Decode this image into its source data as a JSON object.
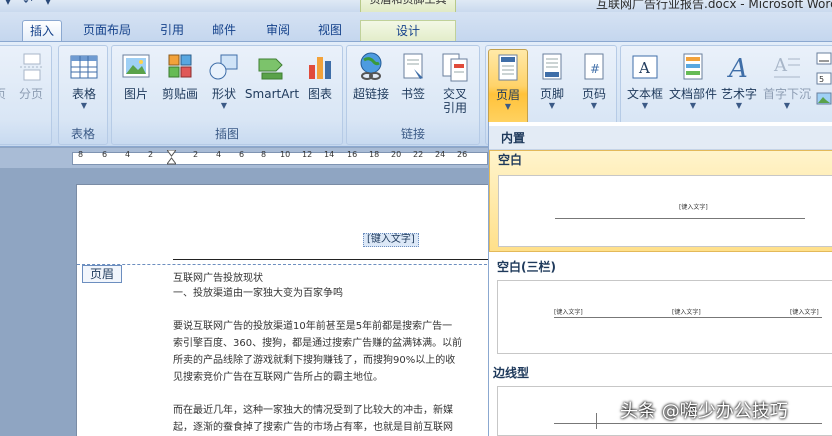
{
  "window": {
    "context_tools_title": "页眉和页脚工具",
    "document_title": "互联网广告行业报告.docx - Microsoft Word"
  },
  "tabs": [
    {
      "label": "插入",
      "active": true
    },
    {
      "label": "页面布局"
    },
    {
      "label": "引用"
    },
    {
      "label": "邮件"
    },
    {
      "label": "审阅"
    },
    {
      "label": "视图"
    },
    {
      "label": "设计",
      "contextual": true
    }
  ],
  "ribbon": {
    "groups": {
      "pages": {
        "partial_label": "页",
        "split_label": "分页"
      },
      "table": {
        "label": "表格",
        "button": "表格"
      },
      "illustrations": {
        "label": "插图",
        "picture": "图片",
        "clipart": "剪贴画",
        "shapes": "形状",
        "smartart": "SmartArt",
        "chart": "图表"
      },
      "links": {
        "label": "链接",
        "hyperlink": "超链接",
        "bookmark": "书签",
        "crossref_1": "交叉",
        "crossref_2": "引用"
      },
      "header_footer": {
        "header": "页眉",
        "footer": "页脚",
        "page_number": "页码"
      },
      "text": {
        "textbox": "文本框",
        "quickparts": "文档部件",
        "wordart": "艺术字",
        "dropcap": "首字下沉"
      }
    }
  },
  "ruler": {
    "ticks": [
      "8",
      "6",
      "4",
      "2",
      "2",
      "4",
      "6",
      "8",
      "10",
      "12",
      "14",
      "16",
      "18",
      "20",
      "22",
      "24",
      "26"
    ]
  },
  "document": {
    "header_field": "[键入文字]",
    "header_tag": "页眉",
    "lines": [
      "互联网广告投放现状",
      "一、投放渠道由一家独大变为百家争鸣",
      "要说互联网广告的投放渠道10年前甚至是5年前都是搜索广告一",
      "索引擎百度、360、搜狗，都是通过搜索广告赚的盆满钵满。以前",
      "所卖的产品线除了游戏就剩下搜狗赚钱了，而搜狗90%以上的收",
      "见搜索竞价广告在互联网广告所占的霸主地位。",
      "而在最近几年，这种一家独大的情况受到了比较大的冲击，新媒",
      "起，逐渐的蚕食掉了搜索广告的市场占有率，也就是目前互联网"
    ]
  },
  "gallery": {
    "section": "内置",
    "items": [
      {
        "name": "空白",
        "placeholder": "[键入文字]",
        "selected": true
      },
      {
        "name": "空白(三栏)",
        "placeholders": [
          "[键入文字]",
          "[键入文字]",
          "[键入文字]"
        ]
      },
      {
        "name": "边线型"
      }
    ]
  },
  "watermark": "头条 @嗨少办公技巧",
  "colors": {
    "accent": "#15428b",
    "ribbon": "#dbe6f4",
    "selected": "#ffd36a"
  }
}
